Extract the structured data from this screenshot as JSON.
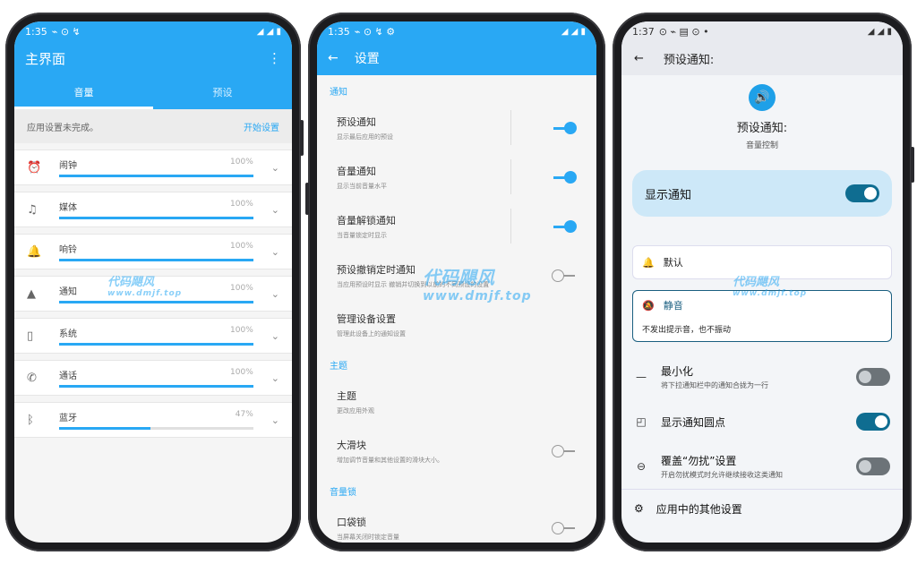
{
  "phone1": {
    "status": {
      "time": "1:35",
      "icons": "◢ ◢ ▮"
    },
    "title": "主界面",
    "menu_icon": "⋮",
    "tabs": [
      {
        "label": "音量"
      },
      {
        "label": "预设"
      }
    ],
    "setup": {
      "message": "应用设置未完成。",
      "link": "开始设置"
    },
    "volumes": [
      {
        "icon": "alarm-icon",
        "glyph": "⏰",
        "label": "闹钟",
        "percent": "100%",
        "value": 1.0
      },
      {
        "icon": "music-icon",
        "glyph": "♫",
        "label": "媒体",
        "percent": "100%",
        "value": 1.0
      },
      {
        "icon": "bell-icon",
        "glyph": "🔔",
        "label": "响铃",
        "percent": "100%",
        "value": 1.0
      },
      {
        "icon": "warning-icon",
        "glyph": "▲",
        "label": "通知",
        "percent": "100%",
        "value": 1.0
      },
      {
        "icon": "phone-device-icon",
        "glyph": "▯",
        "label": "系统",
        "percent": "100%",
        "value": 1.0
      },
      {
        "icon": "call-icon",
        "glyph": "✆",
        "label": "通话",
        "percent": "100%",
        "value": 1.0
      },
      {
        "icon": "bluetooth-icon",
        "glyph": "ᛒ",
        "label": "蓝牙",
        "percent": "47%",
        "value": 0.47
      }
    ]
  },
  "phone2": {
    "status": {
      "time": "1:35",
      "icons": "◢ ◢ ▮"
    },
    "title": "设置",
    "back_icon": "←",
    "sections": [
      {
        "header": "通知",
        "items": [
          {
            "title": "预设通知",
            "summary": "显示最后应用的预设",
            "on": true
          },
          {
            "title": "音量通知",
            "summary": "显示当前音量水平",
            "on": true
          },
          {
            "title": "音量解锁通知",
            "summary": "当音量锁定时显示",
            "on": true
          },
          {
            "title": "预设撤销定时通知",
            "summary": "当应用预设时显示 撤销并切换到以前的不同预设的设置",
            "on": false
          },
          {
            "title": "管理设备设置",
            "summary": "管理此设备上的通知设置",
            "on": null
          }
        ]
      },
      {
        "header": "主题",
        "items": [
          {
            "title": "主题",
            "summary": "更改应用外观",
            "on": null
          },
          {
            "title": "大滑块",
            "summary": "增加调节音量和其他设置的滑块大小。",
            "on": false
          }
        ]
      },
      {
        "header": "音量锁",
        "items": [
          {
            "title": "口袋锁",
            "summary": "当屏幕关闭时锁定音量",
            "on": false
          }
        ]
      }
    ]
  },
  "phone3": {
    "status": {
      "time": "1:37",
      "icons": "◢ ◢ ▮"
    },
    "title": "预设通知:",
    "back_icon": "←",
    "hero": {
      "title": "预设通知:",
      "subtitle": "音量控制"
    },
    "show_notification": {
      "label": "显示通知",
      "on": true
    },
    "options": {
      "default": {
        "label": "默认"
      },
      "silent": {
        "label": "静音",
        "description": "不发出提示音，也不振动"
      }
    },
    "rows": [
      {
        "icon": "minimize-icon",
        "glyph": "—",
        "title": "最小化",
        "summary": "将下拉通知栏中的通知合拢为一行",
        "on": false
      },
      {
        "icon": "badge-icon",
        "glyph": "◰",
        "title": "显示通知圆点",
        "summary": "",
        "on": true
      },
      {
        "icon": "dnd-icon",
        "glyph": "⊖",
        "title": "覆盖“勿扰”设置",
        "summary": "开启勿扰模式时允许继续接收这类通知",
        "on": false
      }
    ],
    "bottom": {
      "label": "应用中的其他设置",
      "glyph": "⚙"
    }
  },
  "watermark": {
    "text": "代码飓风",
    "url": "www.dmjf.top"
  },
  "colors": {
    "accent": "#29a8f4",
    "dark_toggle": "#0f6d91"
  }
}
